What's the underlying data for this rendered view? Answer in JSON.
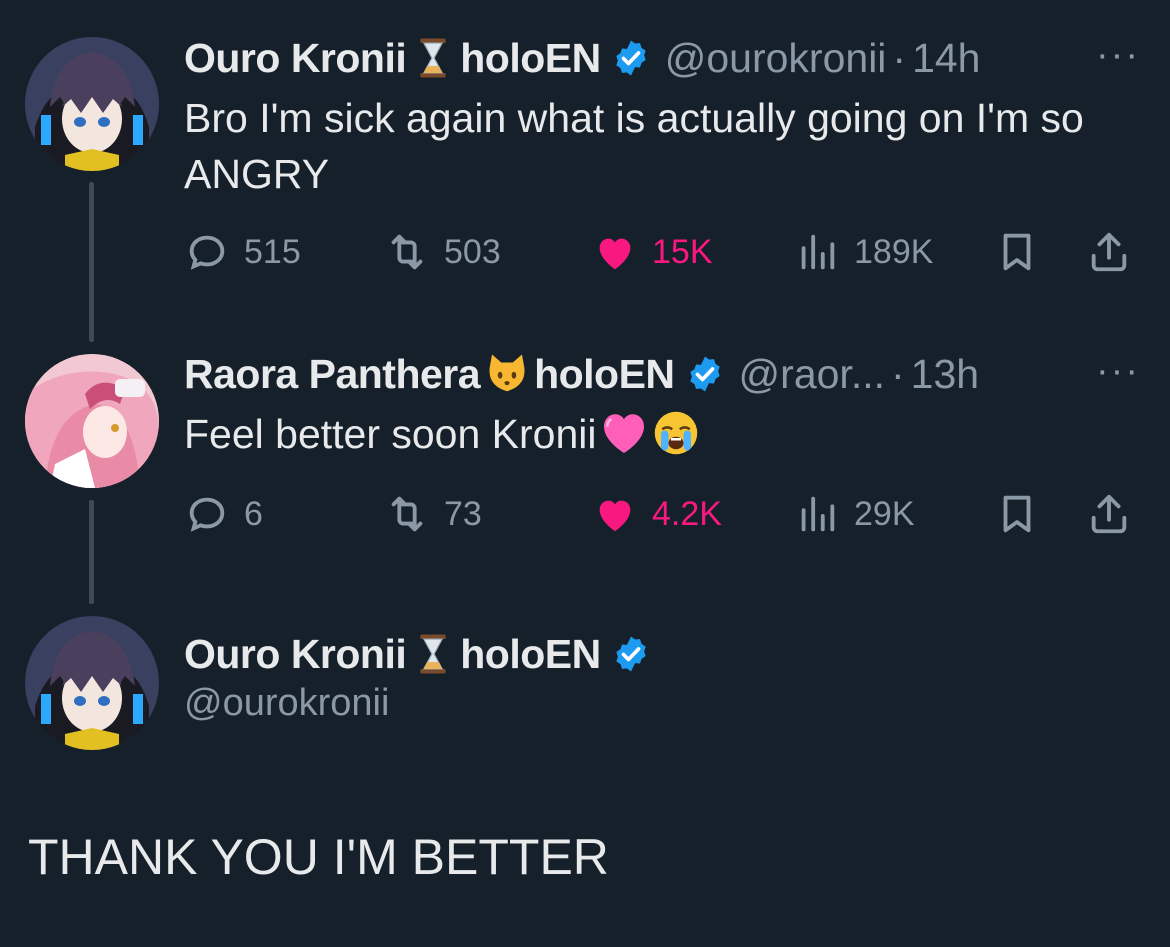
{
  "tweets": [
    {
      "display_name": "Ouro Kronii",
      "name_emoji": "hourglass-icon",
      "org": "holoEN",
      "handle": "@ourokronii",
      "time": "14h",
      "text": "Bro I'm sick again what is actually going on I'm so ANGRY",
      "replies": "515",
      "retweets": "503",
      "likes": "15K",
      "views": "189K"
    },
    {
      "display_name": "Raora Panthera",
      "name_emoji": "cat-face-icon",
      "org": "holoEN",
      "handle": "@raor...",
      "time": "13h",
      "text": "Feel better soon Kronii",
      "text_emojis": [
        "heart-icon",
        "crying-face-icon"
      ],
      "replies": "6",
      "retweets": "73",
      "likes": "4.2K",
      "views": "29K"
    }
  ],
  "focused": {
    "display_name": "Ouro Kronii",
    "name_emoji": "hourglass-icon",
    "org": "holoEN",
    "handle": "@ourokronii",
    "text": "THANK YOU I'M BETTER"
  },
  "ui": {
    "dot": "·",
    "more": "···"
  },
  "colors": {
    "background": "#15202b",
    "text": "#e7e9ea",
    "muted": "#8b98a5",
    "like": "#f91880",
    "verified": "#1d9bf0"
  }
}
